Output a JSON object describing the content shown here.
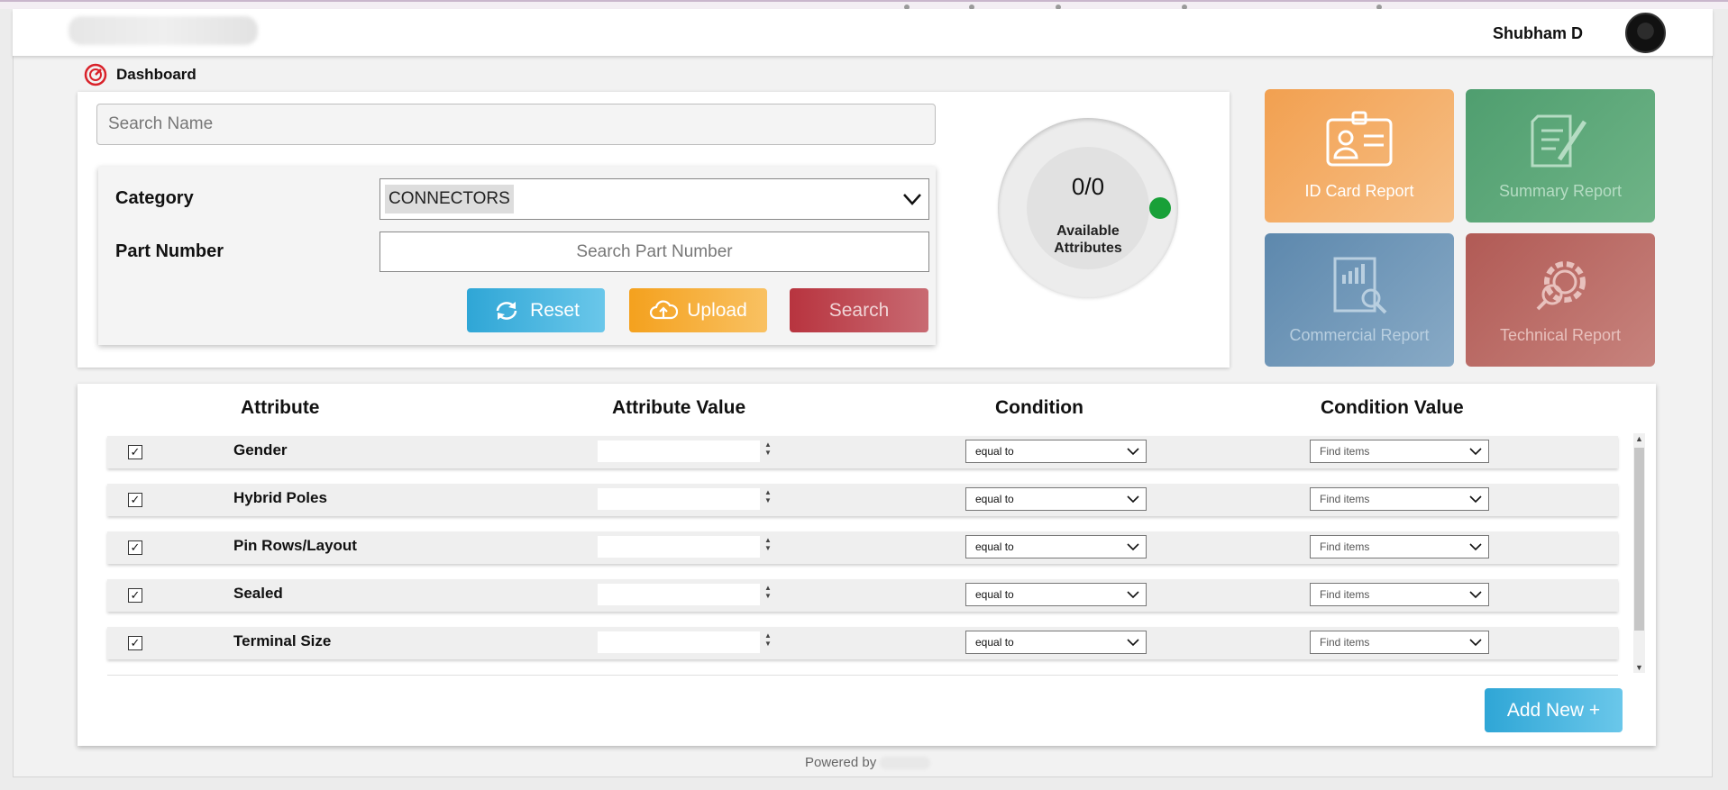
{
  "header": {
    "user_name": "Shubham D"
  },
  "breadcrumb": {
    "label": "Dashboard"
  },
  "search": {
    "name_placeholder": "Search Name"
  },
  "filters": {
    "category_label": "Category",
    "category_value": "CONNECTORS",
    "part_label": "Part Number",
    "part_placeholder": "Search Part Number",
    "reset_label": "Reset",
    "upload_label": "Upload",
    "search_label": "Search"
  },
  "gauge": {
    "value": "0/0",
    "label_line1": "Available",
    "label_line2": "Attributes",
    "status_color": "#18a038"
  },
  "reports": [
    {
      "label": "ID Card Report",
      "icon": "id-card-icon",
      "color": "#f2a050"
    },
    {
      "label": "Summary Report",
      "icon": "report-pen-icon",
      "color": "#4f9e6f"
    },
    {
      "label": "Commercial Report",
      "icon": "chart-search-icon",
      "color": "#5d88ad"
    },
    {
      "label": "Technical Report",
      "icon": "gear-chart-icon",
      "color": "#b15a55"
    }
  ],
  "table": {
    "headers": {
      "attribute": "Attribute",
      "attribute_value": "Attribute Value",
      "condition": "Condition",
      "condition_value": "Condition Value"
    },
    "rows": [
      {
        "name": "Gender",
        "checked": true,
        "condition": "equal to",
        "condition_value_placeholder": "Find items"
      },
      {
        "name": "Hybrid Poles",
        "checked": true,
        "condition": "equal to",
        "condition_value_placeholder": "Find items"
      },
      {
        "name": "Pin Rows/Layout",
        "checked": true,
        "condition": "equal to",
        "condition_value_placeholder": "Find items"
      },
      {
        "name": "Sealed",
        "checked": true,
        "condition": "equal to",
        "condition_value_placeholder": "Find items"
      },
      {
        "name": "Terminal Size",
        "checked": true,
        "condition": "equal to",
        "condition_value_placeholder": "Find items"
      }
    ],
    "add_label": "Add New +"
  },
  "footer": {
    "powered_by": "Powered by"
  },
  "colors": {
    "accent_blue": "#2fa6d6",
    "accent_orange": "#f4a11e",
    "accent_red": "#b8343f"
  }
}
